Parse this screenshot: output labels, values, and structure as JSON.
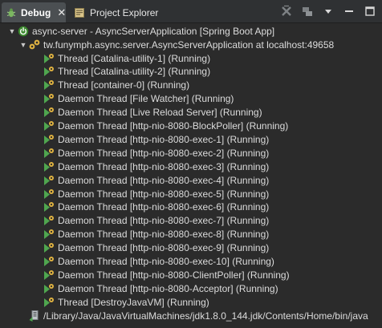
{
  "tabs": [
    {
      "label": "Debug",
      "icon": "debug-bug-icon",
      "active": true
    },
    {
      "label": "Project Explorer",
      "icon": "project-explorer-icon",
      "active": false
    }
  ],
  "tab_close_glyph": "✕",
  "toolbar": [
    "remove-all-terminated-icon",
    "collapse-threads-icon",
    "view-menu-icon",
    "minimize-icon",
    "maximize-icon"
  ],
  "launch": {
    "label": "async-server - AsyncServerApplication [Spring Boot App]",
    "icon": "spring-boot-power-icon"
  },
  "vm": {
    "label": "tw.funymph.async.server.AsyncServerApplication at localhost:49658",
    "icon": "debug-target-icon"
  },
  "threads": [
    {
      "label": "Thread [Catalina-utility-1] (Running)"
    },
    {
      "label": "Thread [Catalina-utility-2] (Running)"
    },
    {
      "label": "Thread [container-0] (Running)"
    },
    {
      "label": "Daemon Thread [File Watcher] (Running)"
    },
    {
      "label": "Daemon Thread [Live Reload Server] (Running)"
    },
    {
      "label": "Daemon Thread [http-nio-8080-BlockPoller] (Running)"
    },
    {
      "label": "Daemon Thread [http-nio-8080-exec-1] (Running)"
    },
    {
      "label": "Daemon Thread [http-nio-8080-exec-2] (Running)"
    },
    {
      "label": "Daemon Thread [http-nio-8080-exec-3] (Running)"
    },
    {
      "label": "Daemon Thread [http-nio-8080-exec-4] (Running)"
    },
    {
      "label": "Daemon Thread [http-nio-8080-exec-5] (Running)"
    },
    {
      "label": "Daemon Thread [http-nio-8080-exec-6] (Running)"
    },
    {
      "label": "Daemon Thread [http-nio-8080-exec-7] (Running)"
    },
    {
      "label": "Daemon Thread [http-nio-8080-exec-8] (Running)"
    },
    {
      "label": "Daemon Thread [http-nio-8080-exec-9] (Running)"
    },
    {
      "label": "Daemon Thread [http-nio-8080-exec-10] (Running)"
    },
    {
      "label": "Daemon Thread [http-nio-8080-ClientPoller] (Running)"
    },
    {
      "label": "Daemon Thread [http-nio-8080-Acceptor] (Running)"
    },
    {
      "label": "Thread [DestroyJavaVM] (Running)"
    }
  ],
  "thread_icon": "running-thread-icon",
  "process": {
    "label": "/Library/Java/JavaVirtualMachines/jdk1.8.0_144.jdk/Contents/Home/bin/java",
    "icon": "java-process-icon"
  },
  "colors": {
    "background": "#2b2b2b",
    "tab_active": "#4b4f52",
    "thread_green": "#4fa64f",
    "gear_gold": "#e0b341",
    "spring_green": "#6db33f"
  }
}
